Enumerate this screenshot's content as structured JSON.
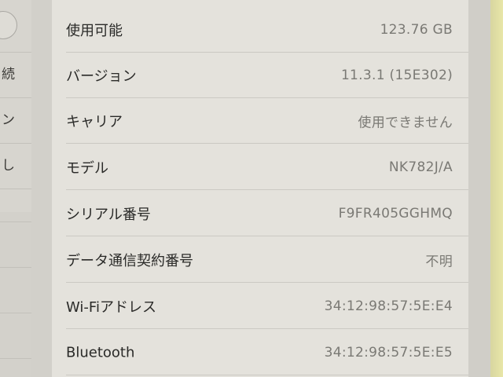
{
  "sidebar": {
    "items": [
      {
        "label": "続"
      },
      {
        "label": "ン"
      },
      {
        "label": "し"
      }
    ]
  },
  "about": {
    "rows": [
      {
        "label": "使用可能",
        "value": "123.76 GB"
      },
      {
        "label": "バージョン",
        "value": "11.3.1 (15E302)"
      },
      {
        "label": "キャリア",
        "value": "使用できません"
      },
      {
        "label": "モデル",
        "value": "NK782J/A"
      },
      {
        "label": "シリアル番号",
        "value": "F9FR405GGHMQ"
      },
      {
        "label": "データ通信契約番号",
        "value": "不明"
      },
      {
        "label": "Wi-Fiアドレス",
        "value": "34:12:98:57:5E:E4"
      },
      {
        "label": "Bluetooth",
        "value": "34:12:98:57:5E:E5"
      }
    ]
  }
}
